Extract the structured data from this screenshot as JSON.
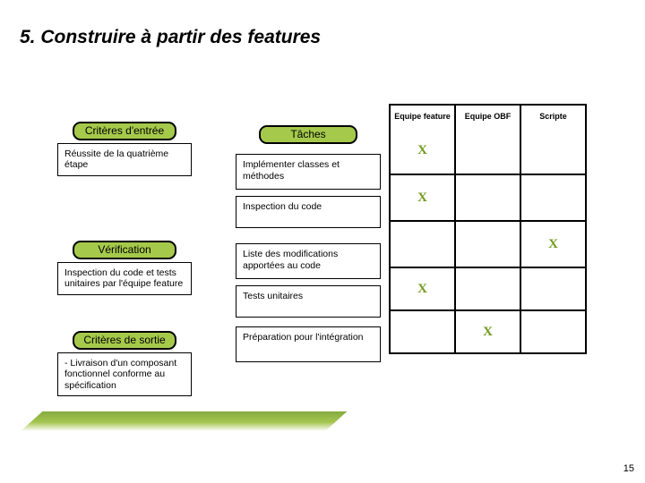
{
  "title": "5. Construire à partir des features",
  "page_number": "15",
  "left": {
    "criteres_entree": {
      "label": "Critères d'entrée",
      "text": "Réussite de la quatrième   étape"
    },
    "verification": {
      "label": "Vérification",
      "text": "Inspection du code et tests unitaires par l'équipe feature"
    },
    "criteres_sortie": {
      "label": "Critères de sortie",
      "text": "- Livraison  d'un composant   fonctionnel conforme au spécification"
    }
  },
  "tasks": {
    "label": "Tâches",
    "items": [
      "Implémenter classes et méthodes",
      "Inspection du code",
      "Liste des modifications apportées au code",
      "Tests unitaires",
      "Préparation pour l'intégration"
    ]
  },
  "chart_data": {
    "type": "table",
    "columns": [
      "Equipe feature",
      "Equipe OBF",
      "Scripte"
    ],
    "rows": [
      {
        "task": "Implémenter classes et méthodes",
        "marks": [
          "X",
          "",
          ""
        ]
      },
      {
        "task": "Inspection du code",
        "marks": [
          "X",
          "",
          ""
        ]
      },
      {
        "task": "Liste des modifications apportées au code",
        "marks": [
          "",
          "",
          "X"
        ]
      },
      {
        "task": "Tests unitaires",
        "marks": [
          "X",
          "",
          ""
        ]
      },
      {
        "task": "Préparation pour l'intégration",
        "marks": [
          "",
          "X",
          ""
        ]
      }
    ]
  }
}
